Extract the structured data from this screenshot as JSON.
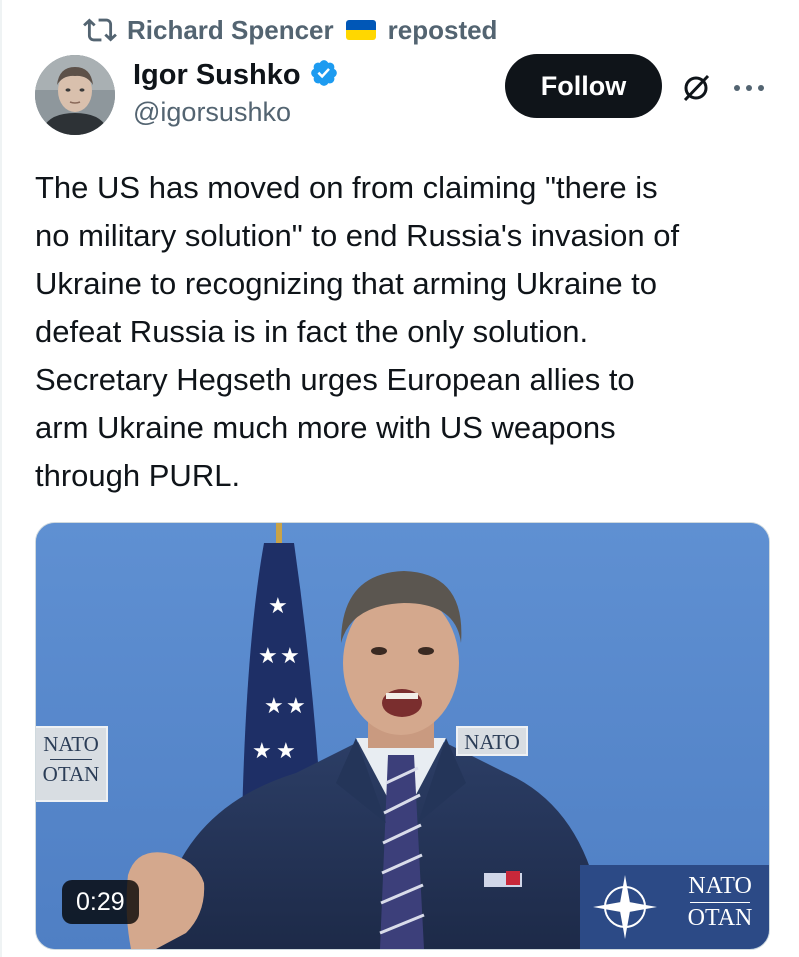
{
  "repost": {
    "icon": "repost-icon",
    "reposter_name": "Richard Spencer",
    "flag_icon": "ukraine-flag-icon",
    "label": "reposted"
  },
  "author": {
    "name": "Igor Sushko",
    "handle": "@igorsushko",
    "verified_icon": "verified-badge-icon",
    "verified_color": "#1d9bf0"
  },
  "actions": {
    "follow_label": "Follow",
    "grok_icon": "grok-icon",
    "more_icon": "more-icon"
  },
  "tweet": {
    "text": "The US has moved on from claiming \"there is\nno military solution\" to end Russia's invasion of\nUkraine to recognizing that arming Ukraine to\ndefeat Russia is in fact the only solution.\nSecretary Hegseth urges European allies to\narm Ukraine much more with US weapons\nthrough PURL."
  },
  "media": {
    "type": "video",
    "duration": "0:29",
    "signs": {
      "left_top": "NATO",
      "left_bottom": "OTAN",
      "center_partial": "NATO",
      "right_top": "NATO",
      "right_bottom": "OTAN"
    }
  },
  "colors": {
    "text_primary": "#0f1419",
    "text_secondary": "#536471",
    "follow_bg": "#0f1419",
    "backdrop_blue": "#5d8fd0"
  }
}
